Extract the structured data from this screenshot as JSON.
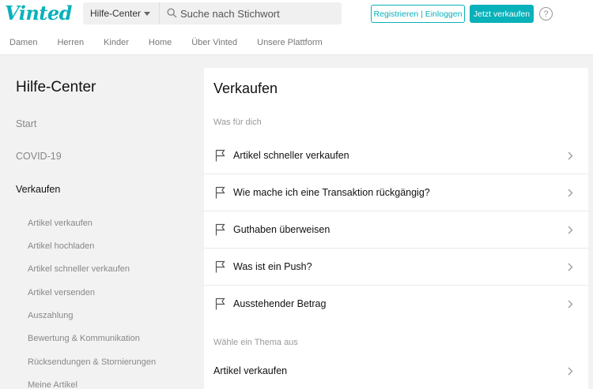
{
  "header": {
    "logo_text": "Vinted",
    "search_category": "Hilfe-Center",
    "search_placeholder": "Suche nach Stichwort",
    "login_label": "Registrieren | Einloggen",
    "sell_label": "Jetzt verkaufen",
    "help_symbol": "?",
    "brand_color": "#09b1ba"
  },
  "categories": [
    "Damen",
    "Herren",
    "Kinder",
    "Home",
    "Über Vinted",
    "Unsere Plattform"
  ],
  "sidebar": {
    "title": "Hilfe-Center",
    "links": [
      "Start",
      "COVID-19",
      "Verkaufen"
    ],
    "active": "Verkaufen",
    "sublinks": [
      "Artikel verkaufen",
      "Artikel hochladen",
      "Artikel schneller verkaufen",
      "Artikel versenden",
      "Auszahlung",
      "Bewertung & Kommunikation",
      "Rücksendungen & Stornierungen",
      "Meine Artikel"
    ]
  },
  "main": {
    "title": "Verkaufen",
    "section1_label": "Was für dich",
    "items": [
      "Artikel schneller verkaufen",
      "Wie mache ich eine Transaktion rückgängig?",
      "Guthaben überweisen",
      "Was ist ein Push?",
      "Ausstehender Betrag"
    ],
    "section2_label": "Wähle ein Thema aus",
    "topics": [
      "Artikel verkaufen"
    ]
  }
}
